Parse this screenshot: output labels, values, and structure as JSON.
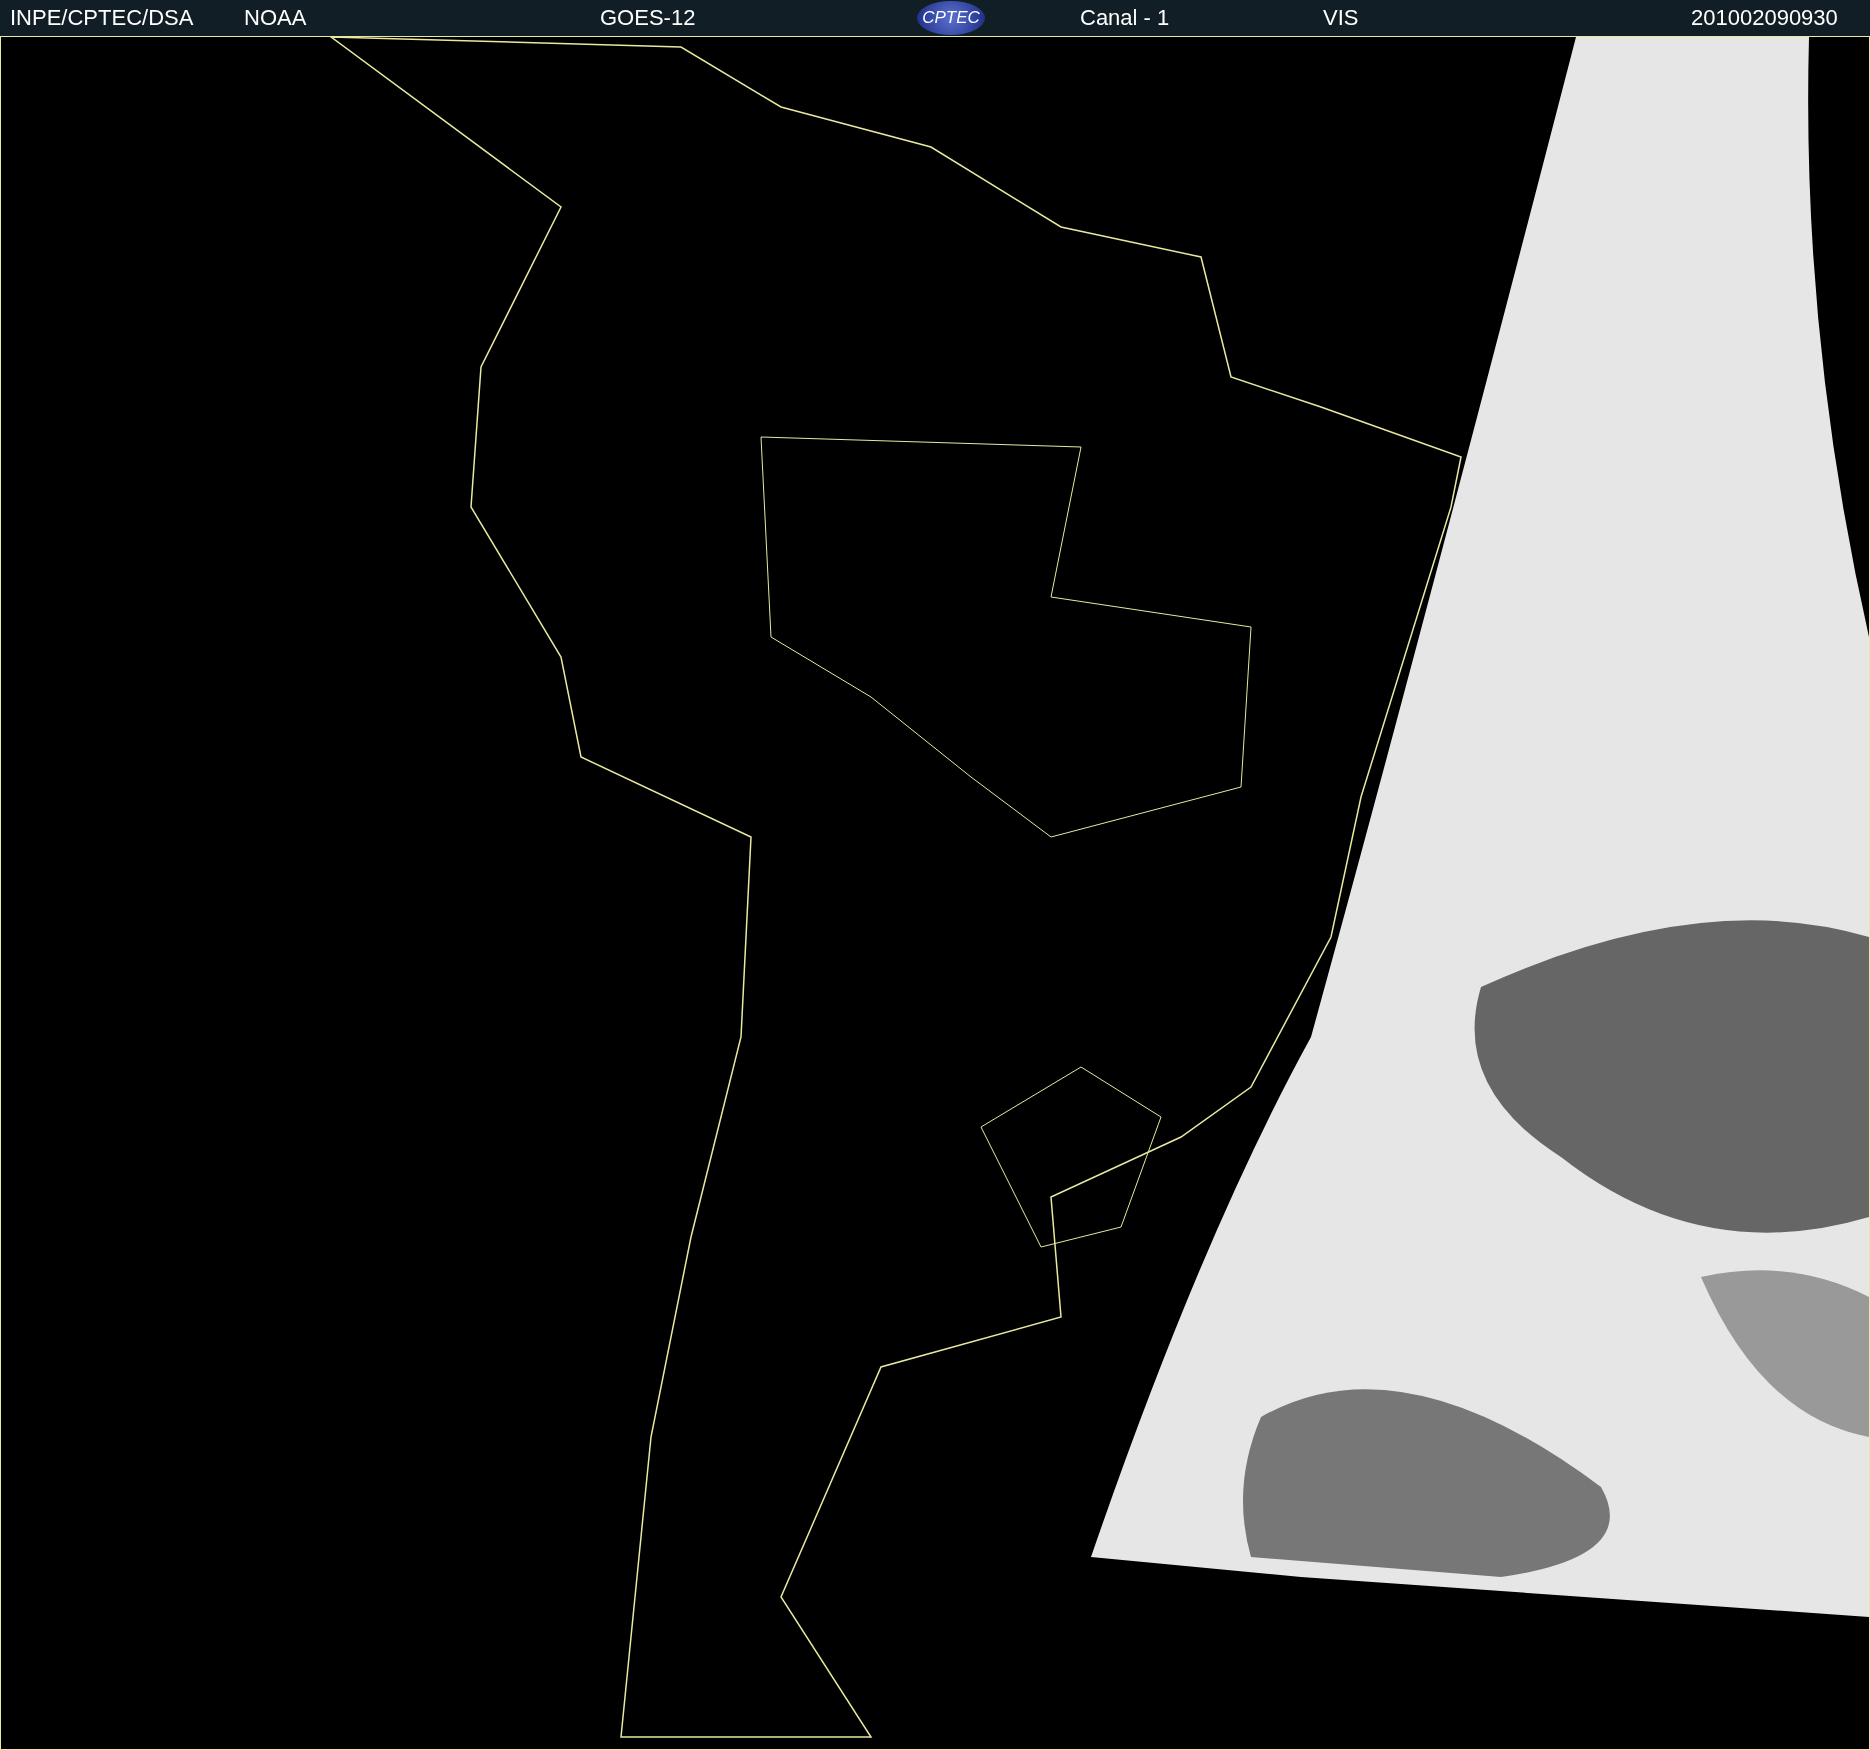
{
  "header": {
    "source": "INPE/CPTEC/DSA",
    "agency": "NOAA",
    "satellite": "GOES-12",
    "logo": "CPTEC",
    "channel": "Canal - 1",
    "band": "VIS",
    "timestamp": "201002090930"
  }
}
